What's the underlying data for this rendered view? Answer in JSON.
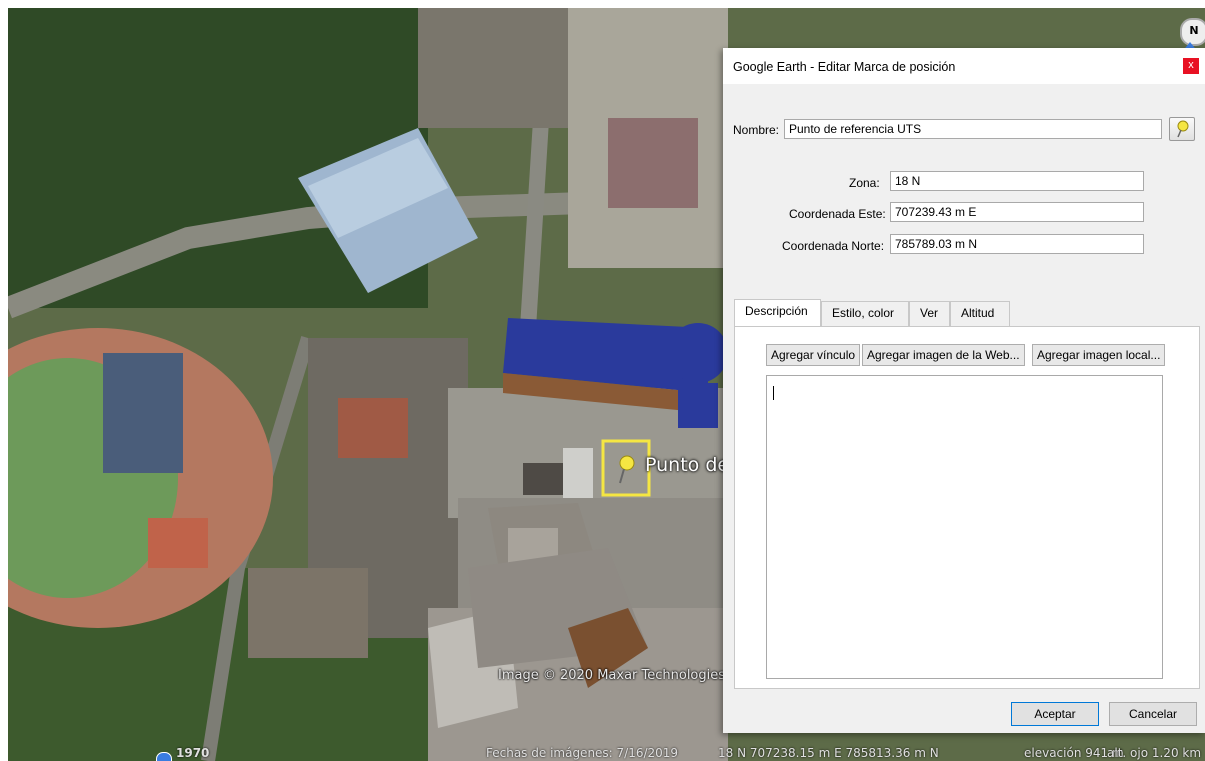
{
  "map": {
    "credit": "Image © 2020 Maxar Technologies",
    "placemark_label": "Punto de",
    "compass_letter": "N",
    "status": {
      "year": "1970",
      "imagery_date": "Fechas de imágenes: 7/16/2019",
      "coordinates": "18 N 707238.15 m E 785813.36 m N",
      "elevation": "elevación   941 m",
      "eye_altitude": "alt. ojo   1.20 km"
    }
  },
  "dialog": {
    "title": "Google Earth - Editar Marca de posición",
    "close_label": "x",
    "name_label": "Nombre:",
    "name_value": "Punto de referencia  UTS",
    "zone_label": "Zona:",
    "zone_value": "18 N",
    "east_label": "Coordenada Este:",
    "east_value": "707239.43 m E",
    "north_label": "Coordenada Norte:",
    "north_value": "785789.03 m N",
    "tabs": [
      {
        "label": "Descripción",
        "active": true
      },
      {
        "label": "Estilo, color",
        "active": false
      },
      {
        "label": "Ver",
        "active": false
      },
      {
        "label": "Altitud",
        "active": false
      }
    ],
    "panel_buttons": [
      "Agregar vínculo",
      "Agregar imagen de la Web...",
      "Agregar imagen local..."
    ],
    "description_value": "",
    "ok_label": "Aceptar",
    "cancel_label": "Cancelar"
  },
  "colors": {
    "placemark": "#f5e642",
    "building_blue": "#2a3a9c",
    "close_red": "#e81123"
  }
}
